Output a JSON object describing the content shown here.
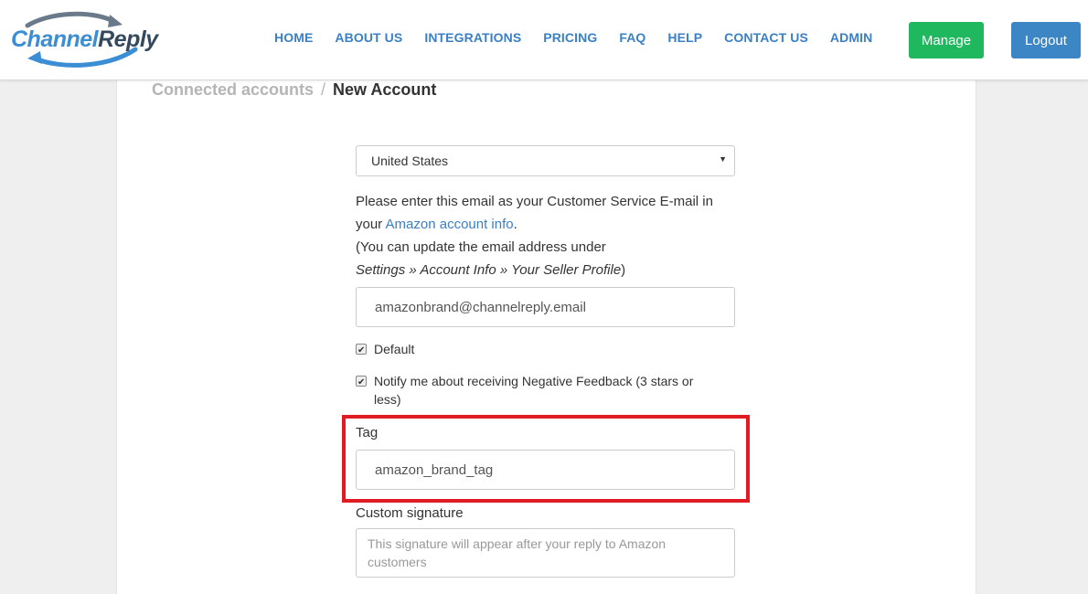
{
  "brand": {
    "name_part1": "Channel",
    "name_part2": "Reply",
    "accent": "#3b8ed4",
    "dark": "#34495e"
  },
  "nav": {
    "items": [
      "HOME",
      "ABOUT US",
      "INTEGRATIONS",
      "PRICING",
      "FAQ",
      "HELP",
      "CONTACT US",
      "ADMIN"
    ]
  },
  "buttons": {
    "manage": "Manage",
    "logout": "Logout",
    "manage_color": "#1fb85f",
    "logout_color": "#3d86c6"
  },
  "breadcrumb": {
    "previous": "Connected accounts",
    "separator": "/",
    "current": "New Account"
  },
  "form": {
    "country": "United States",
    "info_line1": "Please enter this email as your Customer Service E-mail in",
    "info_line2_pre": "your ",
    "info_link": "Amazon account info",
    "info_line2_post": ".",
    "info_line3": "(You can update the email address under",
    "info_line4_path": "Settings » Account Info » Your Seller Profile",
    "info_line4_close": ")",
    "email": "amazonbrand@channelreply.email",
    "default_label": "Default",
    "default_checked": true,
    "notify_label": "Notify me about receiving Negative Feedback (3 stars or less)",
    "notify_checked": true,
    "tag_label": "Tag",
    "tag_value": "amazon_brand_tag",
    "signature_label": "Custom signature",
    "signature_placeholder": "This signature will appear after your reply to Amazon customers"
  },
  "highlight_color": "#e01b24"
}
